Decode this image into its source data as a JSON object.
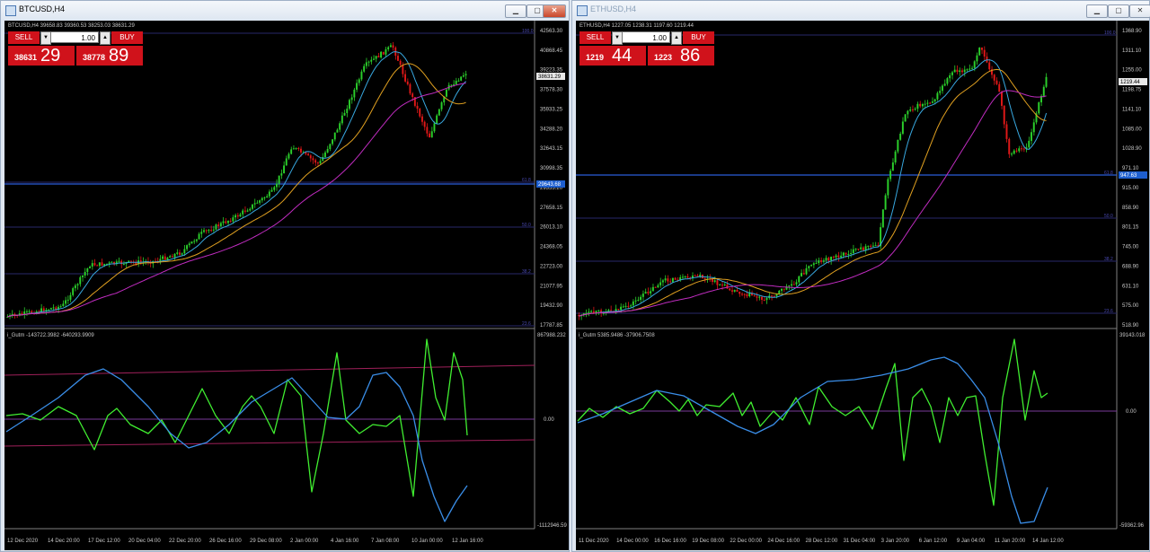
{
  "windows": [
    {
      "id": "btc",
      "title": "BTCUSD,H4",
      "header": "BTCUSD,H4  39658.83 39360.53 38253.03 38631.29",
      "trade": {
        "sell_label": "SELL",
        "buy_label": "BUY",
        "volume": "1.00",
        "sell_small": "38631",
        "sell_big": "29",
        "buy_small": "38778",
        "buy_big": "89"
      },
      "price_axis": [
        "42563.30",
        "40868.45",
        "39223.35",
        "37578.30",
        "35933.25",
        "34288.20",
        "32643.15",
        "30998.35",
        "29353.20",
        "27658.15",
        "26013.10",
        "24368.05",
        "22723.00",
        "21077.95",
        "19432.90",
        "17787.85"
      ],
      "current_price": "38631.29",
      "line_price": "29643.68",
      "fib_labels": [
        "100.0",
        "61.8",
        "50.0",
        "38.2",
        "23.6"
      ],
      "indicator": {
        "label": "i_Gutm -143722.3982 -640293.9909",
        "top": "867988.232",
        "zero": "0.00",
        "bottom": "-1112946.59"
      },
      "time_axis": [
        "12 Dec 2020",
        "14 Dec 20:00",
        "17 Dec 12:00",
        "20 Dec 04:00",
        "22 Dec 20:00",
        "26 Dec 16:00",
        "29 Dec 08:00",
        "2 Jan 00:00",
        "4 Jan 16:00",
        "7 Jan 08:00",
        "10 Jan 00:00",
        "12 Jan 16:00"
      ]
    },
    {
      "id": "eth",
      "title": "ETHUSD,H4",
      "header": "ETHUSD,H4  1227.05 1238.31 1197.60 1219.44",
      "trade": {
        "sell_label": "SELL",
        "buy_label": "BUY",
        "volume": "1.00",
        "sell_small": "1219",
        "sell_big": "44",
        "buy_small": "1223",
        "buy_big": "86"
      },
      "price_axis": [
        "1368.90",
        "1311.10",
        "1255.00",
        "1198.75",
        "1141.10",
        "1085.00",
        "1028.90",
        "971.10",
        "915.00",
        "858.90",
        "801.15",
        "745.00",
        "688.90",
        "631.10",
        "575.00",
        "518.90"
      ],
      "current_price": "1219.44",
      "line_price": "947.63",
      "fib_labels": [
        "100.0",
        "61.8",
        "50.0",
        "38.2",
        "23.6"
      ],
      "indicator": {
        "label": "i_Gutm 5385.9486 -37906.7508",
        "top": "39143.018",
        "zero": "0.00",
        "bottom": "-59362.96"
      },
      "time_axis": [
        "11 Dec 2020",
        "14 Dec 00:00",
        "16 Dec 16:00",
        "19 Dec 08:00",
        "22 Dec 00:00",
        "24 Dec 16:00",
        "28 Dec 12:00",
        "31 Dec 04:00",
        "3 Jan 20:00",
        "6 Jan 12:00",
        "9 Jan 04:00",
        "11 Jan 20:00",
        "14 Jan 12:00"
      ]
    }
  ],
  "colors": {
    "bull": "#2bd02b",
    "bear": "#e01818",
    "ma_fast": "#38a8e0",
    "ma_mid": "#e0a020",
    "ma_slow": "#c02cc0",
    "osc_green": "#40ee30",
    "osc_blue": "#3a8ee8",
    "hline": "#2a5cd8"
  }
}
